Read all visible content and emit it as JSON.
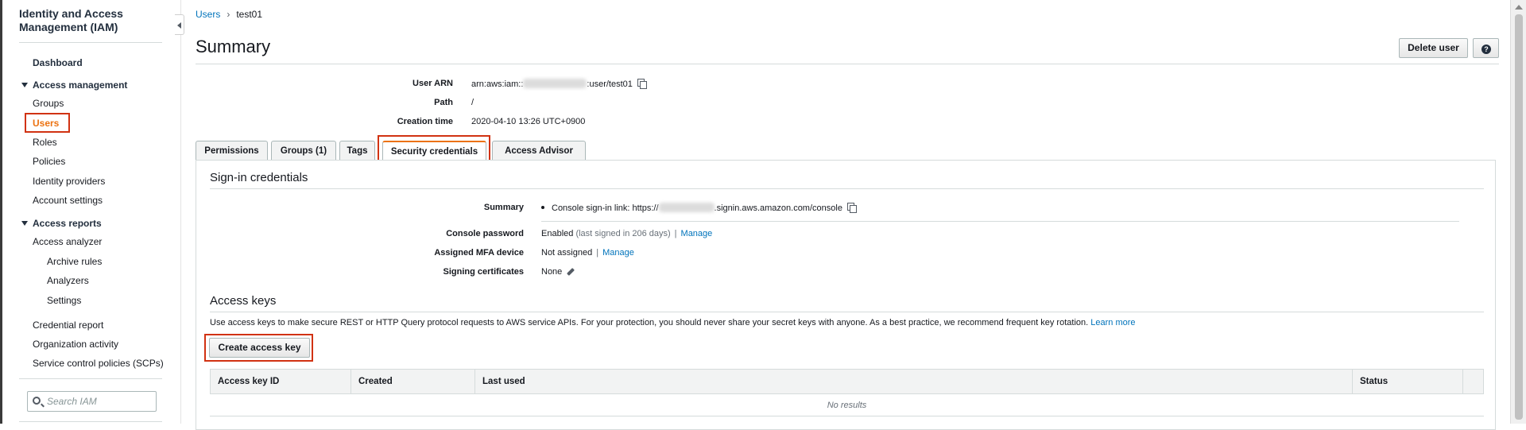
{
  "sidebar": {
    "title": "Identity and Access Management (IAM)",
    "dashboard": "Dashboard",
    "access_management": {
      "label": "Access management",
      "items": [
        "Groups",
        "Users",
        "Roles",
        "Policies",
        "Identity providers",
        "Account settings"
      ]
    },
    "access_reports": {
      "label": "Access reports",
      "analyzer": "Access analyzer",
      "analyzer_sub": [
        "Archive rules",
        "Analyzers",
        "Settings"
      ],
      "items": [
        "Credential report",
        "Organization activity",
        "Service control policies (SCPs)"
      ]
    },
    "search_placeholder": "Search IAM"
  },
  "breadcrumb": {
    "parent": "Users",
    "current": "test01"
  },
  "page": {
    "title": "Summary",
    "delete_button": "Delete user",
    "help_glyph": "?"
  },
  "summary": {
    "arn_label": "User ARN",
    "arn_prefix": "arn:aws:iam::",
    "arn_suffix": ":user/test01",
    "path_label": "Path",
    "path_value": "/",
    "creation_label": "Creation time",
    "creation_value": "2020-04-10 13:26 UTC+0900"
  },
  "tabs": [
    "Permissions",
    "Groups (1)",
    "Tags",
    "Security credentials",
    "Access Advisor"
  ],
  "signin": {
    "title": "Sign-in credentials",
    "summary_label": "Summary",
    "console_link_prefix": "Console sign-in link: ",
    "console_link_start": "https://",
    "console_link_end": ".signin.aws.amazon.com/console",
    "password_label": "Console password",
    "password_value": "Enabled",
    "password_note": "(last signed in 206 days)",
    "manage": "Manage",
    "mfa_label": "Assigned MFA device",
    "mfa_value": "Not assigned",
    "certs_label": "Signing certificates",
    "certs_value": "None"
  },
  "access_keys": {
    "title": "Access keys",
    "description": "Use access keys to make secure REST or HTTP Query protocol requests to AWS service APIs. For your protection, you should never share your secret keys with anyone. As a best practice, we recommend frequent key rotation.",
    "learn_more": "Learn more",
    "create_button": "Create access key",
    "columns": [
      "Access key ID",
      "Created",
      "Last used",
      "Status"
    ],
    "empty": "No results"
  },
  "icons": {
    "copy": "copy-icon",
    "search": "search-icon",
    "pencil": "pencil-icon",
    "collapse": "chevron-left-icon"
  },
  "colors": {
    "accent": "#ec7211",
    "link": "#0073bb",
    "highlight": "#d13212"
  }
}
